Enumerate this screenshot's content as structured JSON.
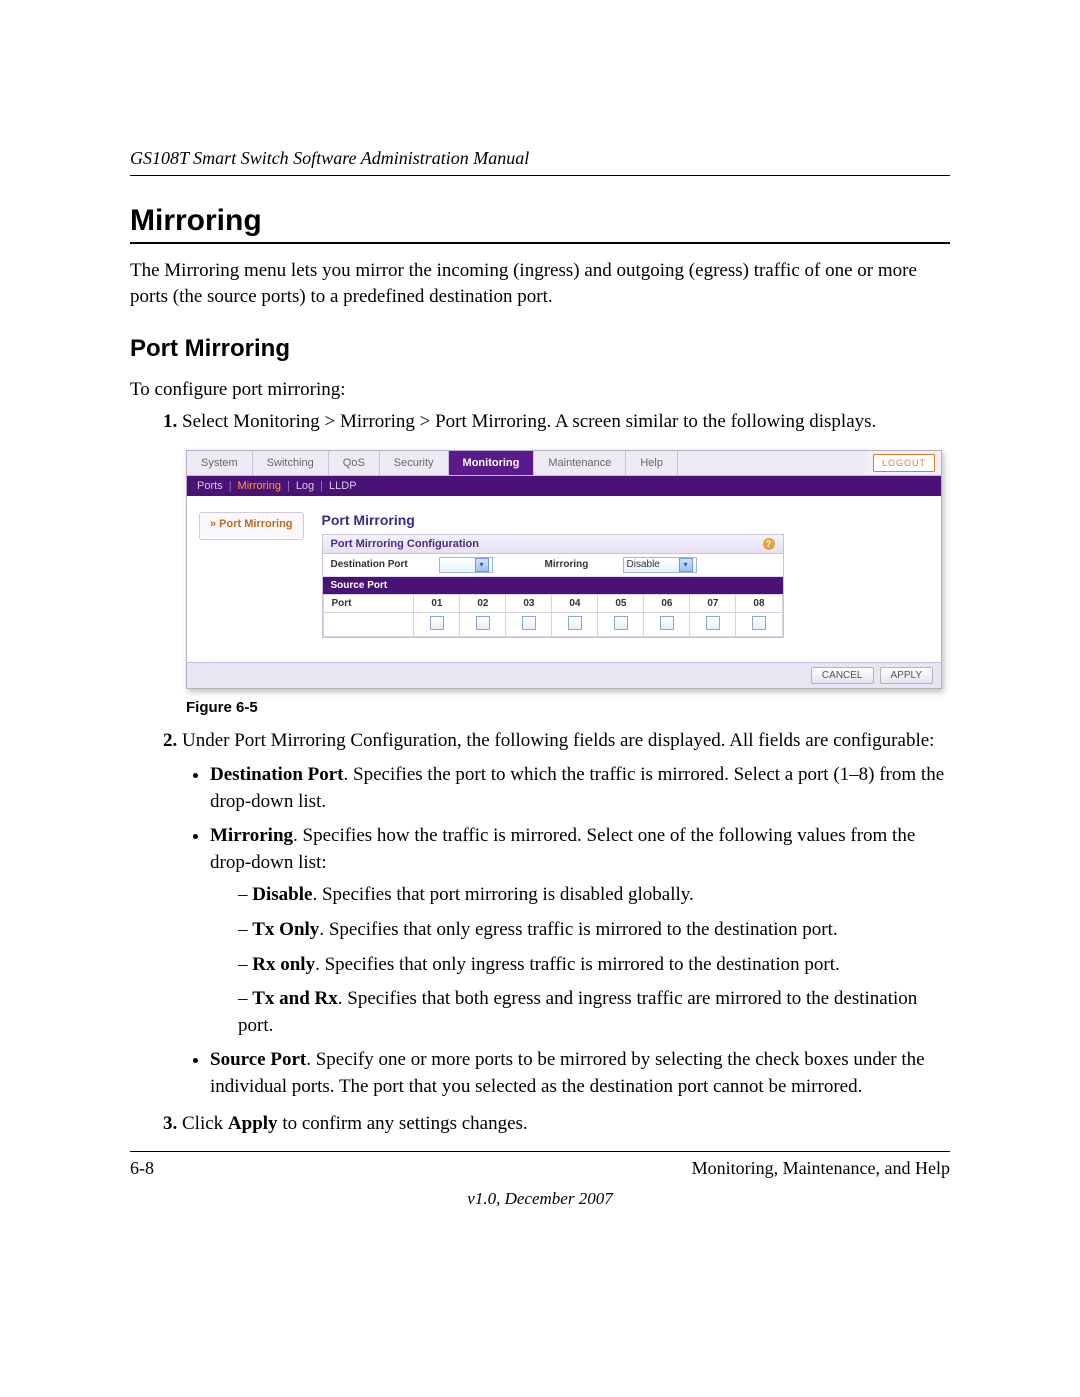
{
  "header": "GS108T Smart Switch Software Administration Manual",
  "title": "Mirroring",
  "intro": "The Mirroring menu lets you mirror the incoming (ingress) and outgoing (egress) traffic of one or more ports (the source ports) to a predefined destination port.",
  "subsection": "Port Mirroring",
  "lead": "To configure port mirroring:",
  "steps": {
    "s1": "Select Monitoring > Mirroring > Port Mirroring. A screen similar to the following displays.",
    "s2": "Under Port Mirroring Configuration, the following fields are displayed. All fields are configurable:",
    "s3_pre": "Click ",
    "s3_bold": "Apply",
    "s3_post": " to confirm any settings changes."
  },
  "bullets": {
    "dest_b": "Destination Port",
    "dest_t": ". Specifies the port to which the traffic is mirrored. Select a port (1–8) from the drop-down list.",
    "mir_b": "Mirroring",
    "mir_t": ". Specifies how the traffic is mirrored. Select one of the following values from the drop-down list:",
    "src_b": "Source Port",
    "src_t": ". Specify one or more ports to be mirrored by selecting the check boxes under the individual ports. The port that you selected as the destination port cannot be mirrored."
  },
  "dashes": {
    "d1b": "Disable",
    "d1t": ". Specifies that port mirroring is disabled globally.",
    "d2b": "Tx Only",
    "d2t": ". Specifies that only egress traffic is mirrored to the destination port.",
    "d3b": "Rx only",
    "d3t": ". Specifies that only ingress traffic is mirrored to the destination port.",
    "d4b": "Tx and Rx",
    "d4t": ". Specifies that both egress and ingress traffic are mirrored to the destination port."
  },
  "figure": "Figure 6-5",
  "footer": {
    "left": "6-8",
    "right": "Monitoring, Maintenance, and Help",
    "version": "v1.0, December 2007"
  },
  "ui": {
    "tabs": {
      "system": "System",
      "switching": "Switching",
      "qos": "QoS",
      "security": "Security",
      "monitoring": "Monitoring",
      "maintenance": "Maintenance",
      "help": "Help"
    },
    "logout": "LOGOUT",
    "subnav": {
      "ports": "Ports",
      "mirroring": "Mirroring",
      "log": "Log",
      "lldp": "LLDP"
    },
    "side": "» Port Mirroring",
    "panel": "Port Mirroring",
    "conf_title": "Port Mirroring Configuration",
    "dest_label": "Destination Port",
    "mir_label": "Mirroring",
    "mir_value": "Disable",
    "src_header": "Source Port",
    "port_label": "Port",
    "ports": [
      "01",
      "02",
      "03",
      "04",
      "05",
      "06",
      "07",
      "08"
    ],
    "cancel": "CANCEL",
    "apply": "APPLY"
  }
}
